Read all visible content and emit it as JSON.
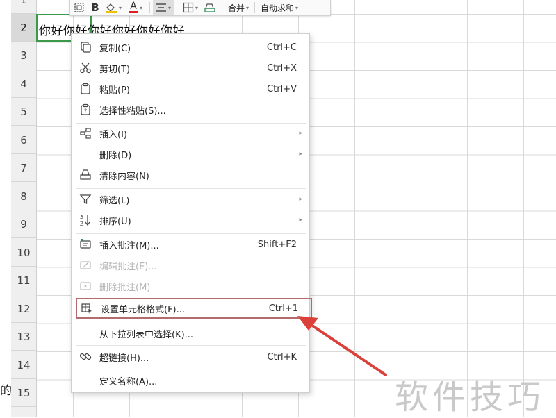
{
  "toolbar": {
    "bold_label": "B",
    "font_color_label": "A",
    "merge_label": "合并",
    "autosum_label": "自动求和"
  },
  "sheet": {
    "row_numbers": [
      "1",
      "2",
      "3",
      "4",
      "5",
      "6",
      "7",
      "8",
      "9",
      "10",
      "11",
      "12",
      "13",
      "14",
      "15"
    ],
    "active_row": "2",
    "cell_text": "你好你好你好你好你好你好",
    "left_clipped_text": "的"
  },
  "context_menu": {
    "items": [
      {
        "label": "复制(C)",
        "shortcut": "Ctrl+C",
        "icon": "copy-icon"
      },
      {
        "label": "剪切(T)",
        "shortcut": "Ctrl+X",
        "icon": "scissors-icon"
      },
      {
        "label": "粘贴(P)",
        "shortcut": "Ctrl+V",
        "icon": "paste-icon"
      },
      {
        "label": "选择性粘贴(S)...",
        "shortcut": "",
        "icon": "paste-special-icon"
      },
      {
        "label": "插入(I)",
        "shortcut": "",
        "icon": "insert-icon",
        "submenu": true
      },
      {
        "label": "删除(D)",
        "shortcut": "",
        "icon": "",
        "submenu": true
      },
      {
        "label": "清除内容(N)",
        "shortcut": "",
        "icon": "eraser-icon"
      },
      {
        "label": "筛选(L)",
        "shortcut": "",
        "icon": "filter-icon",
        "submenu": true
      },
      {
        "label": "排序(U)",
        "shortcut": "",
        "icon": "sort-icon",
        "submenu": true
      },
      {
        "label": "插入批注(M)...",
        "shortcut": "Shift+F2",
        "icon": "comment-insert-icon"
      },
      {
        "label": "编辑批注(E)...",
        "shortcut": "",
        "icon": "comment-edit-icon",
        "disabled": true
      },
      {
        "label": "删除批注(M)",
        "shortcut": "",
        "icon": "comment-delete-icon",
        "disabled": true
      },
      {
        "label": "设置单元格格式(F)...",
        "shortcut": "Ctrl+1",
        "icon": "format-cells-icon",
        "highlighted": true
      },
      {
        "label": "从下拉列表中选择(K)...",
        "shortcut": "",
        "icon": ""
      },
      {
        "label": "超链接(H)...",
        "shortcut": "Ctrl+K",
        "icon": "link-icon"
      },
      {
        "label": "定义名称(A)...",
        "shortcut": "",
        "icon": ""
      }
    ]
  },
  "watermark": "软件技巧",
  "colors": {
    "selection_border": "#3a9a4a",
    "highlight_border": "#b56b6b",
    "arrow": "#d9413a"
  }
}
